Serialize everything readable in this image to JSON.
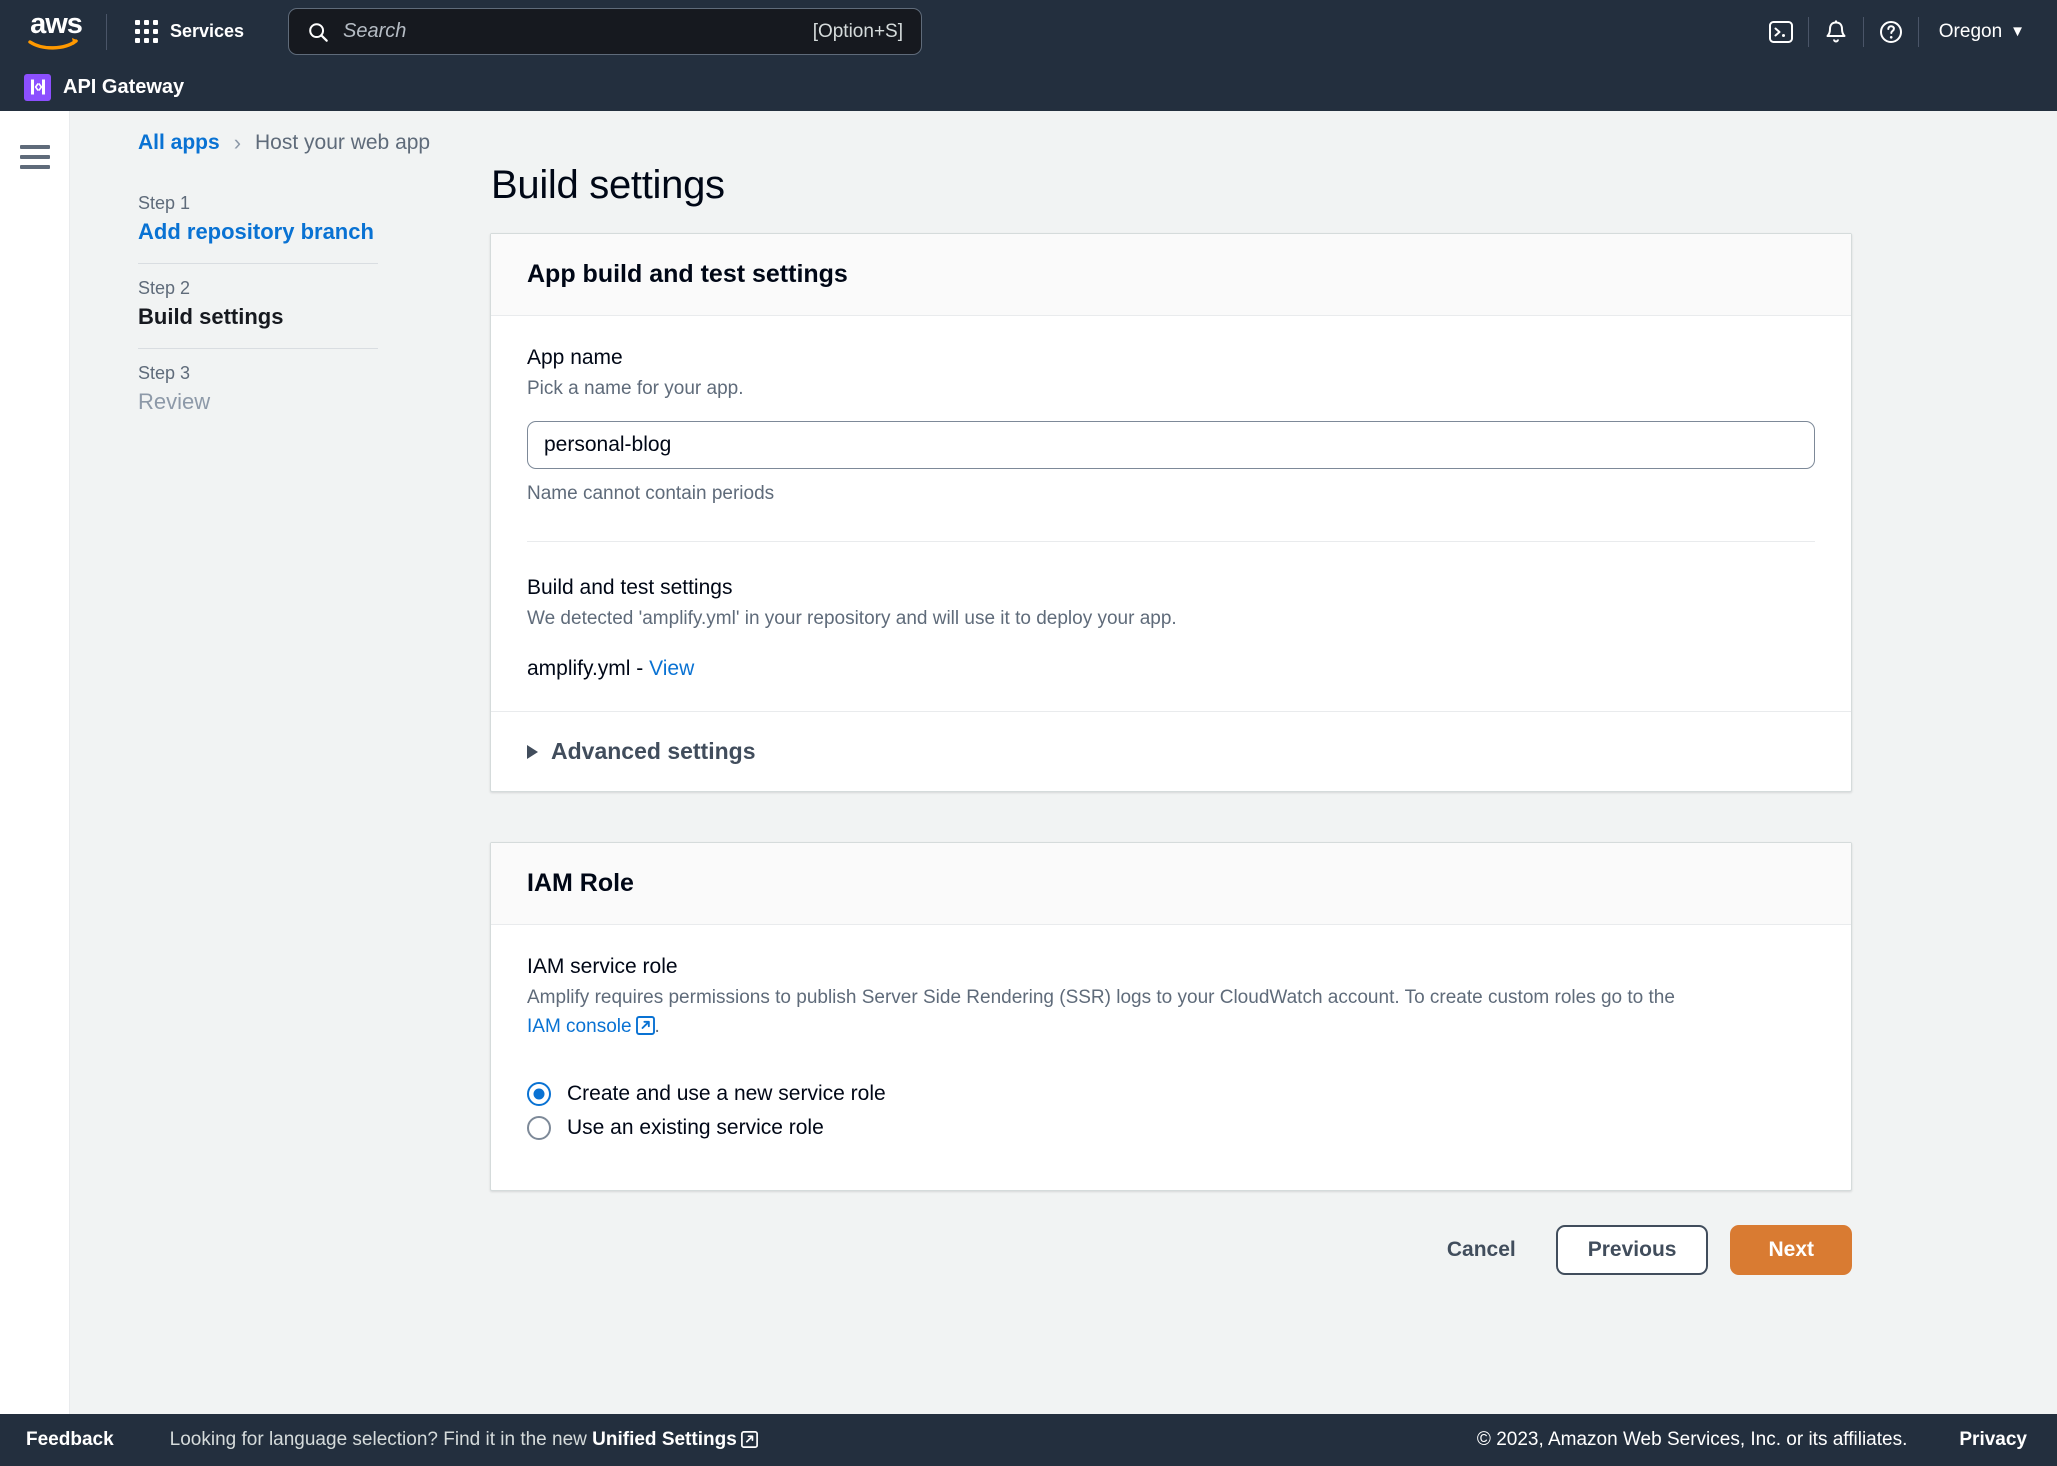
{
  "topnav": {
    "logo_text": "aws",
    "services_label": "Services",
    "search": {
      "placeholder": "Search",
      "shortcut": "[Option+S]"
    },
    "icons": [
      {
        "name": "cloudshell-icon"
      },
      {
        "name": "notifications-bell-icon"
      },
      {
        "name": "help-question-icon"
      }
    ],
    "region": "Oregon"
  },
  "servicebar": {
    "service_name": "API Gateway"
  },
  "breadcrumb": {
    "root": "All apps",
    "separator": "›",
    "current": "Host your web app"
  },
  "steps": [
    {
      "label": "Step 1",
      "title": "Add repository branch",
      "state": "link"
    },
    {
      "label": "Step 2",
      "title": "Build settings",
      "state": "active"
    },
    {
      "label": "Step 3",
      "title": "Review",
      "state": "muted"
    }
  ],
  "main": {
    "page_title": "Build settings",
    "build_card": {
      "header": "App build and test settings",
      "app_name": {
        "label": "App name",
        "description": "Pick a name for your app.",
        "value": "personal-blog",
        "constraint": "Name cannot contain periods"
      },
      "build_and_test": {
        "label": "Build and test settings",
        "description": "We detected 'amplify.yml' in your repository and will use it to deploy your app.",
        "file_name": "amplify.yml -",
        "view_link": "View"
      },
      "advanced_settings_label": "Advanced settings"
    },
    "iam_card": {
      "header": "IAM Role",
      "service_role": {
        "label": "IAM service role",
        "description_before": "Amplify requires permissions to publish Server Side Rendering (SSR) logs to your CloudWatch account. To create custom roles go to the ",
        "link_text": "IAM console",
        "description_after": "."
      },
      "options": [
        {
          "label": "Create and use a new service role",
          "selected": true
        },
        {
          "label": "Use an existing service role",
          "selected": false
        }
      ]
    },
    "actions": {
      "cancel": "Cancel",
      "previous": "Previous",
      "next": "Next"
    }
  },
  "footer": {
    "feedback": "Feedback",
    "language_prompt": "Looking for language selection? Find it in the new ",
    "language_link": "Unified Settings",
    "copyright": "© 2023, Amazon Web Services, Inc. or its affiliates.",
    "privacy": "Privacy"
  },
  "colors": {
    "nav_bg": "#232f3e",
    "page_bg": "#f1f3f3",
    "link": "#0972d3",
    "primary_button": "#d97b32",
    "service_icon": "#8c4fff"
  }
}
